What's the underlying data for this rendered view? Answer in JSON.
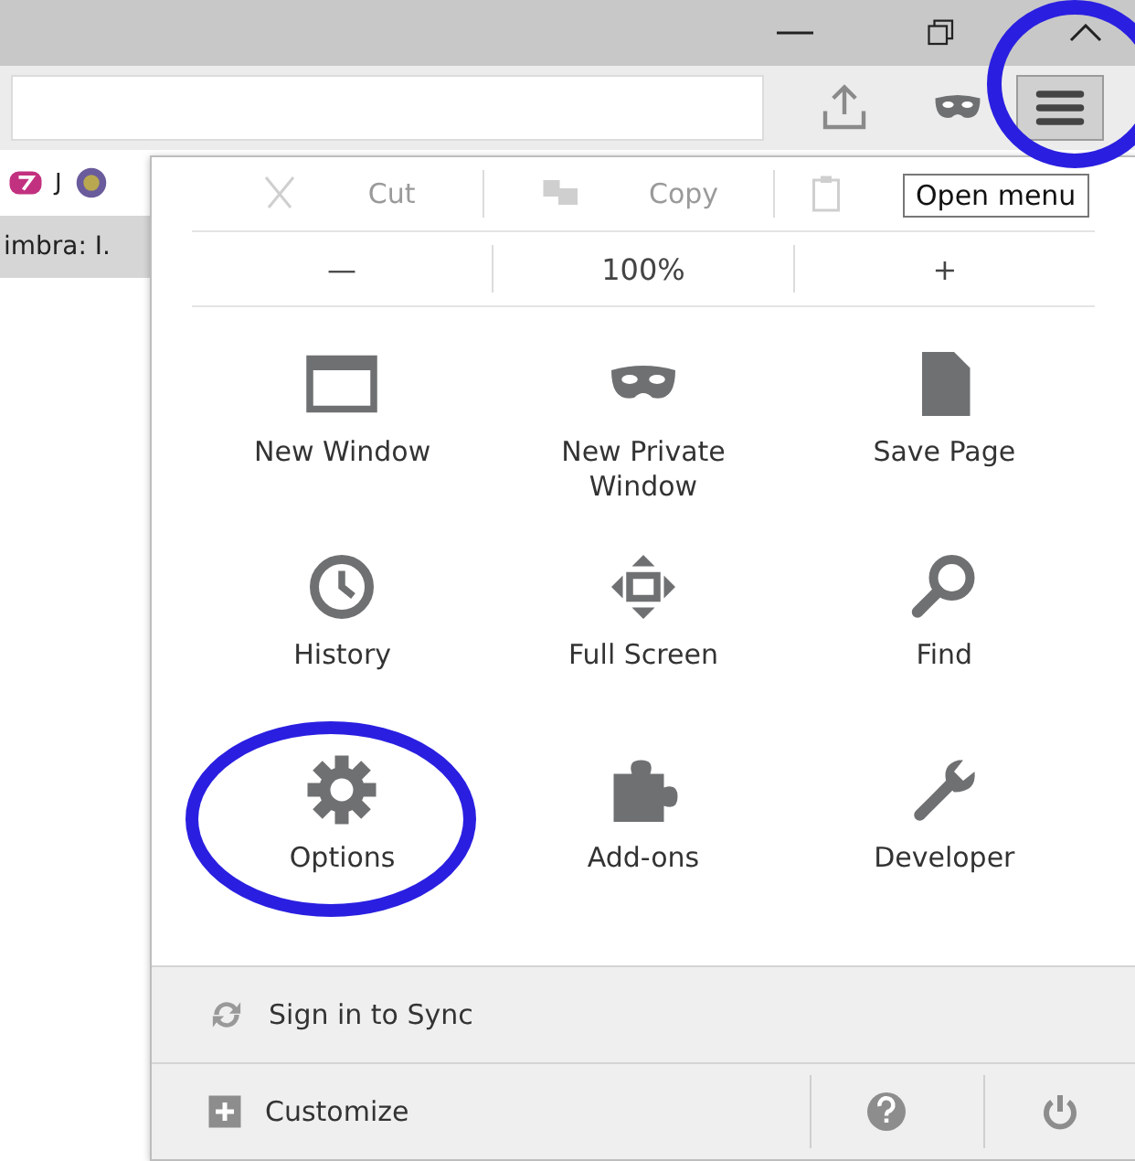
{
  "window_controls": [
    {
      "kind": "minimize"
    },
    {
      "kind": "restore"
    },
    {
      "kind": "close"
    }
  ],
  "toolbar": {
    "buttons": [
      {
        "kind": "share",
        "selected": false
      },
      {
        "kind": "mask",
        "selected": false
      },
      {
        "kind": "menu",
        "selected": true
      }
    ]
  },
  "bookmarks": [
    {
      "kind": "logo",
      "label": "J"
    },
    {
      "kind": "round"
    }
  ],
  "tab": {
    "label": "imbra: I."
  },
  "tooltip": "Open menu",
  "menu": {
    "edit": [
      {
        "kind": "cut",
        "label": "Cut",
        "disabled": true
      },
      {
        "kind": "copy",
        "label": "Copy",
        "disabled": true
      },
      {
        "kind": "paste",
        "disabled": true
      }
    ],
    "zoom": {
      "minus": "—",
      "level": "100%",
      "plus": "+"
    },
    "items": [
      {
        "kind": "window",
        "label": "New Window"
      },
      {
        "kind": "mask",
        "label": "New Private Window"
      },
      {
        "kind": "page",
        "label": "Save Page"
      },
      {
        "kind": "clock",
        "label": "History"
      },
      {
        "kind": "fullscreen",
        "label": "Full Screen"
      },
      {
        "kind": "search",
        "label": "Find"
      },
      {
        "kind": "gear",
        "label": "Options",
        "circled": true
      },
      {
        "kind": "puzzle",
        "label": "Add-ons"
      },
      {
        "kind": "wrench",
        "label": "Developer"
      }
    ],
    "sync": {
      "label": "Sign in to Sync"
    },
    "customize": {
      "label": "Customize"
    },
    "footer_buttons": [
      {
        "kind": "help"
      },
      {
        "kind": "power"
      }
    ]
  },
  "menu_button_circled": true
}
